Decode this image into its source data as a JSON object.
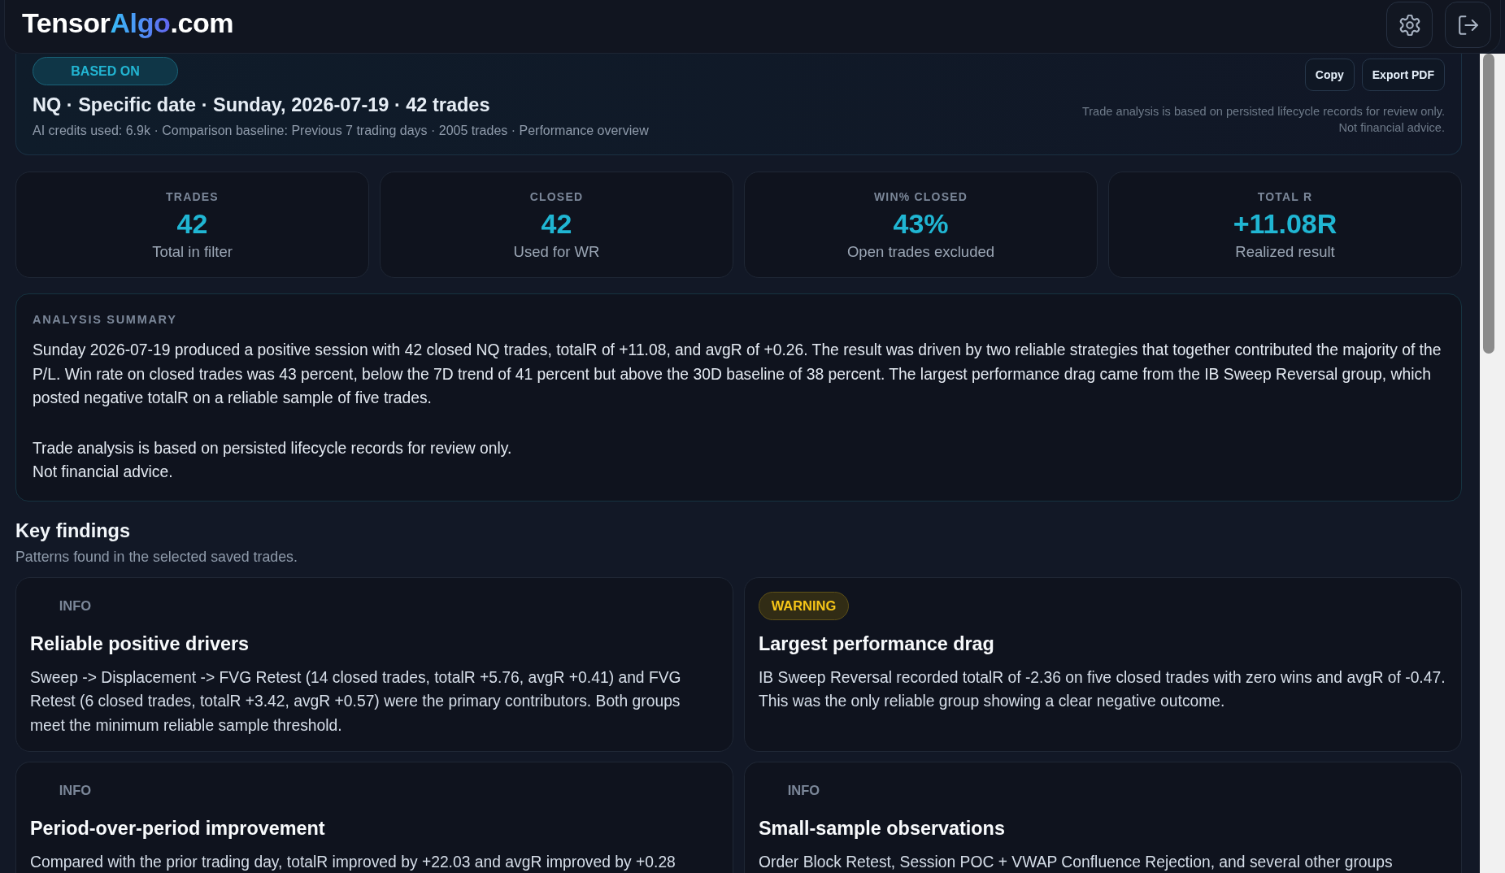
{
  "header": {
    "logo": {
      "prefix": "Tensor",
      "accent": "Algo",
      "suffix": ".com"
    }
  },
  "context": {
    "badge": "BASED ON",
    "title": "NQ · Specific date · Sunday, 2026-07-19 · 42 trades",
    "meta": "AI credits used: 6.9k · Comparison baseline: Previous 7 trading days · 2005 trades · Performance overview",
    "buttons": [
      "Copy",
      "Export PDF"
    ],
    "disclaimer": "Trade analysis is based on persisted lifecycle records for review only.\nNot financial advice."
  },
  "stats": [
    {
      "label": "TRADES",
      "value": "42",
      "caption": "Total in filter"
    },
    {
      "label": "CLOSED",
      "value": "42",
      "caption": "Used for WR"
    },
    {
      "label": "WIN% CLOSED",
      "value": "43%",
      "caption": "Open trades excluded"
    },
    {
      "label": "TOTAL R",
      "value": "+11.08R",
      "caption": "Realized result"
    }
  ],
  "summary": {
    "label": "ANALYSIS SUMMARY",
    "paragraphs": [
      "Sunday 2026-07-19 produced a positive session with 42 closed NQ trades, totalR of +11.08, and avgR of +0.26. The result was driven by two reliable strategies that together contributed the majority of the P/L. Win rate on closed trades was 43 percent, below the 7D trend of 41 percent but above the 30D baseline of 38 percent. The largest performance drag came from the IB Sweep Reversal group, which posted negative totalR on a reliable sample of five trades.",
      "Trade analysis is based on persisted lifecycle records for review only.\nNot financial advice."
    ]
  },
  "key_findings": {
    "title": "Key findings",
    "subtitle": "Patterns found in the selected saved trades.",
    "items": [
      {
        "kind": "info",
        "badge": "INFO",
        "title": "Reliable positive drivers",
        "text": "Sweep -> Displacement -> FVG Retest (14 closed trades, totalR +5.76, avgR +0.41) and FVG Retest (6 closed trades, totalR +3.42, avgR +0.57) were the primary contributors. Both groups meet the minimum reliable sample threshold."
      },
      {
        "kind": "warning",
        "badge": "WARNING",
        "title": "Largest performance drag",
        "text": "IB Sweep Reversal recorded totalR of -2.36 on five closed trades with zero wins and avgR of -0.47. This was the only reliable group showing a clear negative outcome."
      },
      {
        "kind": "info",
        "badge": "INFO",
        "title": "Period-over-period improvement",
        "text": "Compared with the prior trading day, totalR improved by +22.03 and avgR improved by +0.28"
      },
      {
        "kind": "info",
        "badge": "INFO",
        "title": "Small-sample observations",
        "text": "Order Block Retest, Session POC + VWAP Confluence Rejection, and several other groups"
      }
    ]
  }
}
